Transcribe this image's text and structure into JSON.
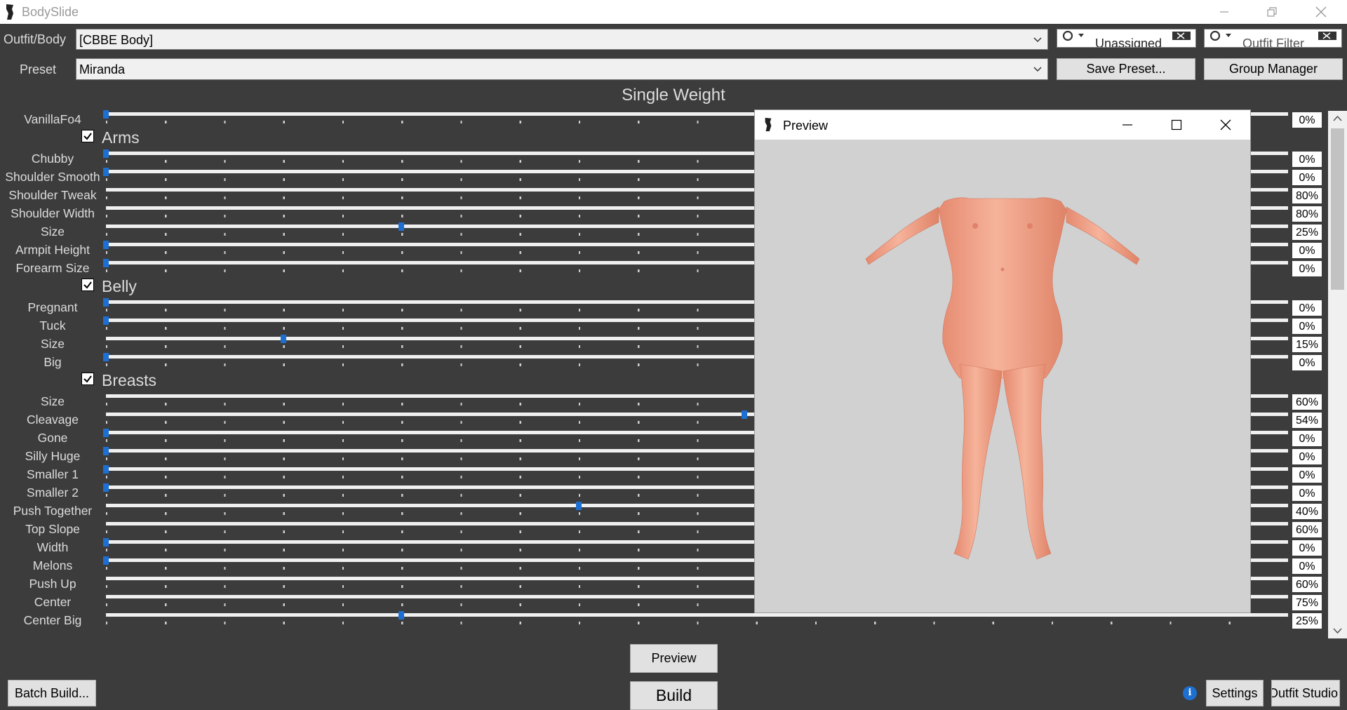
{
  "app": {
    "title": "BodySlide"
  },
  "toolbar": {
    "outfit_label": "Outfit/Body",
    "outfit_value": "[CBBE Body]",
    "preset_label": "Preset",
    "preset_value": "Miranda",
    "group_filter_text": "Unassigned",
    "outfit_filter_text": "Outfit Filter",
    "save_preset_label": "Save Preset...",
    "group_manager_label": "Group Manager"
  },
  "weight_title": "Single Weight",
  "slider_rows": [
    {
      "type": "slider",
      "label": "VanillaFo4",
      "value": 0,
      "display": "0%"
    },
    {
      "type": "group",
      "label": "Arms",
      "checked": true
    },
    {
      "type": "slider",
      "label": "Chubby",
      "value": 0,
      "display": "0%"
    },
    {
      "type": "slider",
      "label": "Shoulder Smooth",
      "value": 0,
      "display": "0%"
    },
    {
      "type": "slider",
      "label": "Shoulder Tweak",
      "value": 80,
      "display": "80%"
    },
    {
      "type": "slider",
      "label": "Shoulder Width",
      "value": 80,
      "display": "80%"
    },
    {
      "type": "slider",
      "label": "Size",
      "value": 25,
      "display": "25%"
    },
    {
      "type": "slider",
      "label": "Armpit Height",
      "value": 0,
      "display": "0%"
    },
    {
      "type": "slider",
      "label": "Forearm Size",
      "value": 0,
      "display": "0%"
    },
    {
      "type": "group",
      "label": "Belly",
      "checked": true
    },
    {
      "type": "slider",
      "label": "Pregnant",
      "value": 0,
      "display": "0%"
    },
    {
      "type": "slider",
      "label": "Tuck",
      "value": 0,
      "display": "0%"
    },
    {
      "type": "slider",
      "label": "Size",
      "value": 15,
      "display": "15%"
    },
    {
      "type": "slider",
      "label": "Big",
      "value": 0,
      "display": "0%"
    },
    {
      "type": "group",
      "label": "Breasts",
      "checked": true
    },
    {
      "type": "slider",
      "label": "Size",
      "value": 60,
      "display": "60%"
    },
    {
      "type": "slider",
      "label": "Cleavage",
      "value": 54,
      "display": "54%"
    },
    {
      "type": "slider",
      "label": "Gone",
      "value": 0,
      "display": "0%"
    },
    {
      "type": "slider",
      "label": "Silly Huge",
      "value": 0,
      "display": "0%"
    },
    {
      "type": "slider",
      "label": "Smaller 1",
      "value": 0,
      "display": "0%"
    },
    {
      "type": "slider",
      "label": "Smaller 2",
      "value": 0,
      "display": "0%"
    },
    {
      "type": "slider",
      "label": "Push Together",
      "value": 40,
      "display": "40%"
    },
    {
      "type": "slider",
      "label": "Top Slope",
      "value": 60,
      "display": "60%"
    },
    {
      "type": "slider",
      "label": "Width",
      "value": 0,
      "display": "0%"
    },
    {
      "type": "slider",
      "label": "Melons",
      "value": 0,
      "display": "0%"
    },
    {
      "type": "slider",
      "label": "Push Up",
      "value": 60,
      "display": "60%"
    },
    {
      "type": "slider",
      "label": "Center",
      "value": 75,
      "display": "75%"
    },
    {
      "type": "slider",
      "label": "Center Big",
      "value": 25,
      "display": "25%"
    }
  ],
  "preview_window": {
    "title": "Preview"
  },
  "bottom": {
    "preview_label": "Preview",
    "build_label": "Build",
    "batch_build_label": "Batch Build...",
    "settings_label": "Settings",
    "outfit_studio_label": "Outfit Studio",
    "info_glyph": "i"
  },
  "colors": {
    "background": "#3c3c3c",
    "slider_thumb": "#1e6fd2",
    "viewport": "#d1d1d1",
    "skin": "#f0a78f"
  }
}
